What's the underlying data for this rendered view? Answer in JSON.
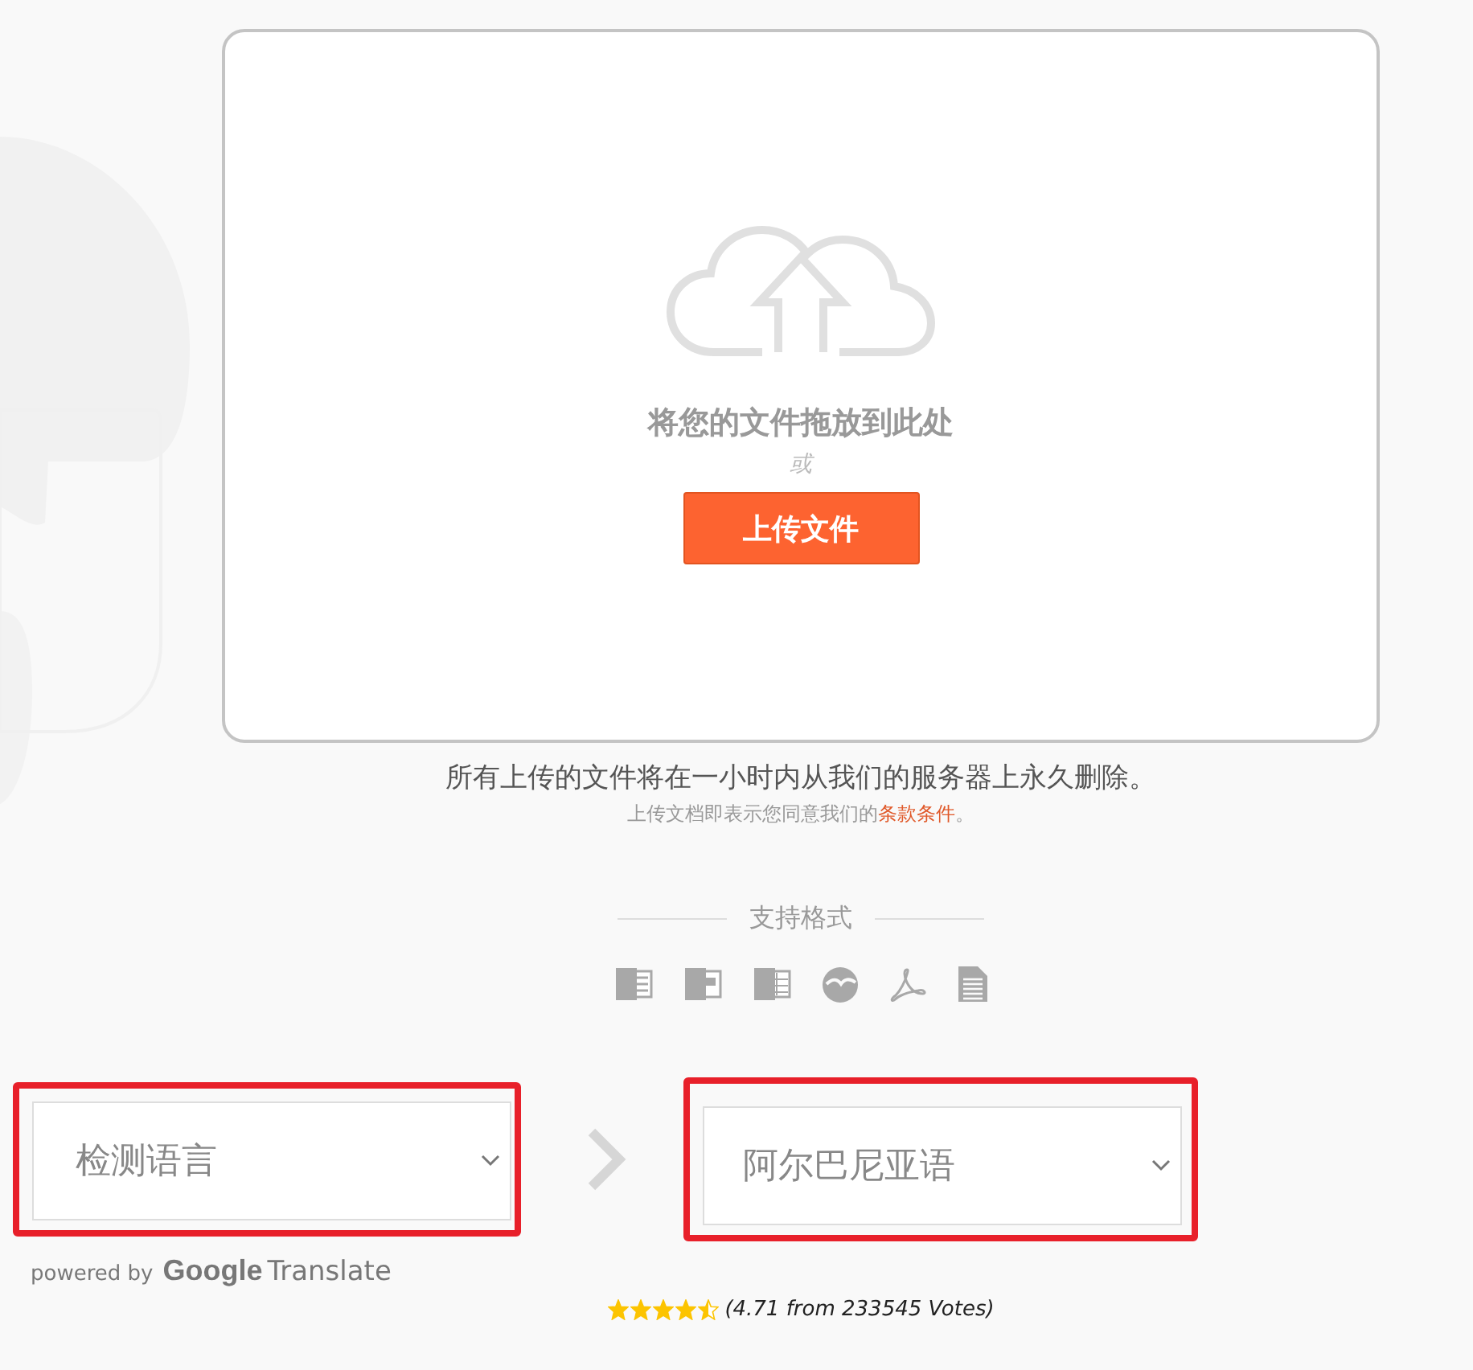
{
  "upload": {
    "drop_text": "将您的文件拖放到此处",
    "or_text": "或",
    "button": "上传文件"
  },
  "notice": "所有上传的文件将在一小时内从我们的服务器上永久删除。",
  "terms": {
    "text": "上传文档即表示您同意我们的",
    "link": "条款条件",
    "end": "。"
  },
  "formats": {
    "title": "支持格式",
    "items": [
      {
        "kind": "word"
      },
      {
        "kind": "powerpoint"
      },
      {
        "kind": "excel"
      },
      {
        "kind": "openoffice"
      },
      {
        "kind": "pdf"
      },
      {
        "kind": "text"
      }
    ]
  },
  "source_language": {
    "value": "检测语言",
    "highlighted": true
  },
  "target_language": {
    "value": "阿尔巴尼亚语",
    "highlighted": true
  },
  "powered_by": {
    "text": "powered by",
    "brand": "Google",
    "product": "Translate"
  },
  "rating": {
    "stars": 4.5,
    "text": "(4.71 from 233545 Votes)"
  }
}
